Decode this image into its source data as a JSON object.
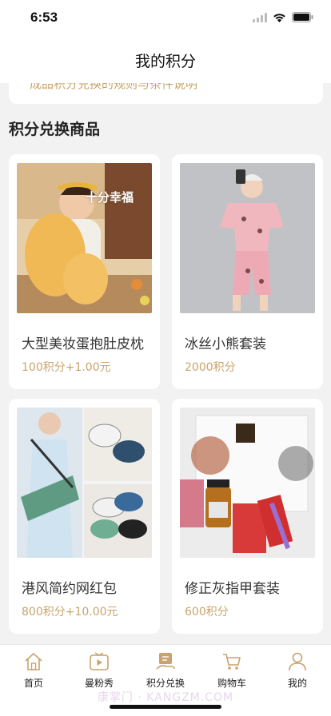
{
  "status_bar": {
    "time": "6:53"
  },
  "nav": {
    "title": "我的积分"
  },
  "top_card": {
    "text": "成品积分兑换的规则与条件说明"
  },
  "section": {
    "title": "积分兑换商品"
  },
  "products": [
    {
      "name": "大型美妆蛋抱肚皮枕",
      "price": "100积分+1.00元",
      "image_caption": "十分幸福"
    },
    {
      "name": "冰丝小熊套装",
      "price": "2000积分"
    },
    {
      "name": "港风简约网红包",
      "price": "800积分+10.00元"
    },
    {
      "name": "修正灰指甲套装",
      "price": "600积分"
    }
  ],
  "tab_bar": {
    "items": [
      {
        "label": "首页",
        "icon": "home-icon"
      },
      {
        "label": "曼粉秀",
        "icon": "video-play-icon"
      },
      {
        "label": "积分兑换",
        "icon": "points-exchange-icon"
      },
      {
        "label": "购物车",
        "icon": "cart-icon"
      },
      {
        "label": "我的",
        "icon": "profile-icon"
      }
    ]
  },
  "watermark": {
    "text": "康掌门 · KANGZM.COM"
  },
  "colors": {
    "accent": "#c8a46a",
    "background": "#f2f2f2",
    "icon": "#c9a26d"
  }
}
